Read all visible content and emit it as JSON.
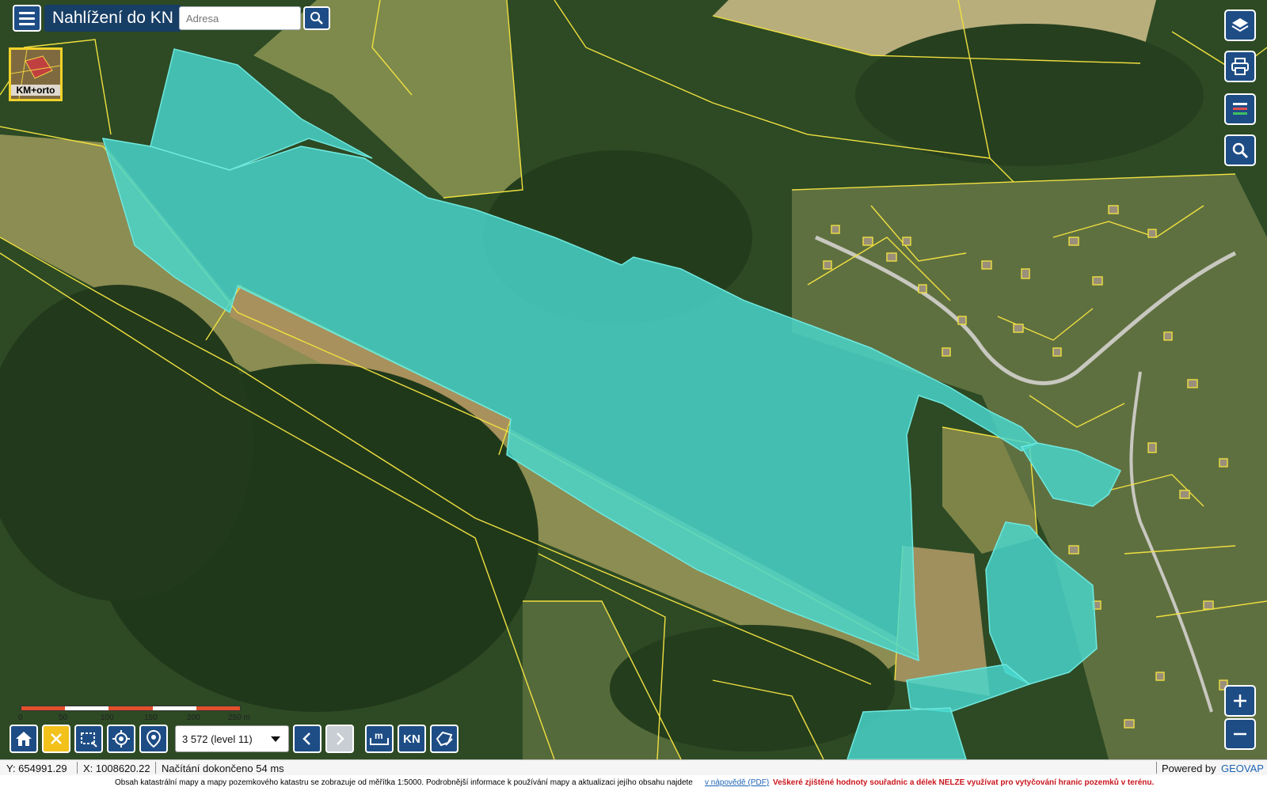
{
  "app": {
    "title": "Nahlížení do KN"
  },
  "search": {
    "placeholder": "Adresa"
  },
  "basemap": {
    "label": "KM+orto"
  },
  "scalebar": {
    "labels": [
      "0",
      "50",
      "100",
      "150",
      "200",
      "250 m"
    ]
  },
  "toolbar": {
    "scale_value": "3 572 (level 11)",
    "kn_label": "KN"
  },
  "status": {
    "y": "Y: 654991.29",
    "x": "X: 1008620.22",
    "message": "Načítání dokončeno 54 ms",
    "powered": "Powered by",
    "powered_brand": "GEOVAP"
  },
  "footer": {
    "text": "Obsah katastrální mapy a mapy pozemkového katastru se zobrazuje od měřítka 1:5000. Podrobnější informace k používání mapy a aktualizaci jejího obsahu najdete",
    "link": "v nápovědě (PDF)",
    "warning": "Veškeré zjištěné hodnoty souřadnic a délek NELZE využívat pro vytyčování hranic pozemků v terénu."
  },
  "colors": {
    "header_bg": "#1e4d86",
    "parcel_fill": "#48d8d0",
    "parcel_line": "#f0e040",
    "active_tool": "#f2c21b",
    "warning": "#c8161d"
  },
  "icons": [
    "menu-icon",
    "search-icon",
    "layers-icon",
    "print-icon",
    "legend-icon",
    "zoom-search-icon",
    "zoom-in-icon",
    "zoom-out-icon",
    "home-icon",
    "close-icon",
    "select-area-icon",
    "locate-icon",
    "pin-icon",
    "chevron-down-icon",
    "prev-icon",
    "next-icon",
    "measure-icon",
    "draw-icon"
  ]
}
